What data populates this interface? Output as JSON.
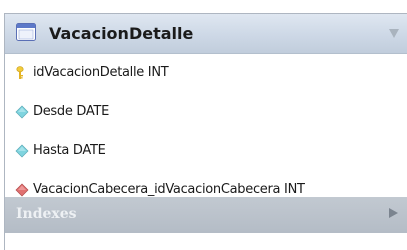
{
  "table": {
    "title": "VacacionDetalle",
    "icon": "table-icon",
    "colors": {
      "header": "#c9d4e2",
      "indexes_bar": "#b8c0ca"
    }
  },
  "columns": [
    {
      "text": "idVacacionDetalle INT",
      "icon": "primary-key-icon",
      "icon_color": "#f2cc3a"
    },
    {
      "text": "Desde DATE",
      "icon": "column-diamond-icon",
      "icon_color": "#7fd4df"
    },
    {
      "text": "Hasta DATE",
      "icon": "column-diamond-icon",
      "icon_color": "#7fd4df"
    },
    {
      "text": "VacacionCabecera_idVacacionCabecera INT",
      "icon": "foreign-key-diamond-icon",
      "icon_color": "#e07070"
    }
  ],
  "indexes": {
    "label": "Indexes"
  }
}
